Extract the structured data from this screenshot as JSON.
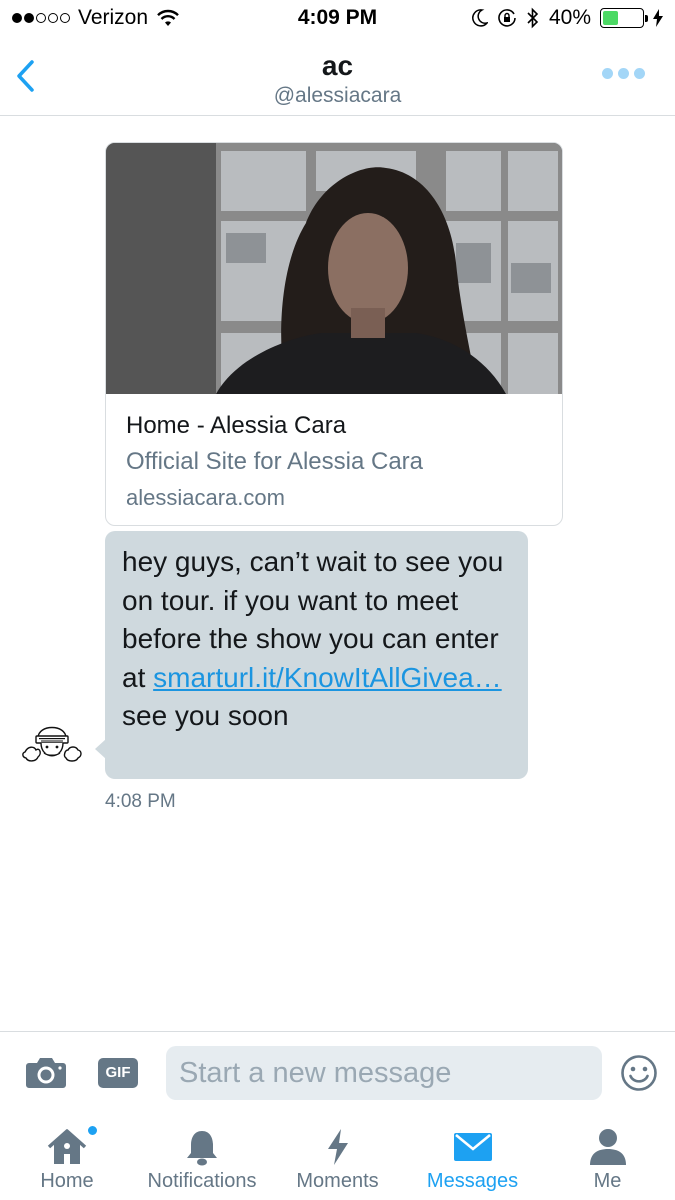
{
  "status_bar": {
    "carrier": "Verizon",
    "time": "4:09 PM",
    "battery": "40%",
    "battery_level": 0.4,
    "signal_bars_filled": 2,
    "signal_bars_total": 5
  },
  "header": {
    "title": "ac",
    "handle": "@alessiacara"
  },
  "card": {
    "title": "Home - Alessia Cara",
    "description": "Official Site for Alessia Cara",
    "domain": "alessiacara.com"
  },
  "message": {
    "text_before": "hey guys, can’t wait to see you on tour. if you want to meet before the show you can enter at",
    "link": "smarturl.it/KnowItAllGivea…",
    "text_after": "see you soon",
    "timestamp": "4:08 PM"
  },
  "composer": {
    "placeholder": "Start a new message",
    "gif_label": "GIF"
  },
  "tabs": [
    {
      "label": "Home",
      "icon": "home-icon",
      "badge": true
    },
    {
      "label": "Notifications",
      "icon": "bell-icon"
    },
    {
      "label": "Moments",
      "icon": "lightning-icon"
    },
    {
      "label": "Messages",
      "icon": "envelope-icon",
      "active": true
    },
    {
      "label": "Me",
      "icon": "person-icon"
    }
  ],
  "colors": {
    "accent": "#1da1f2",
    "bubble": "#cfd9de",
    "muted": "#657786"
  }
}
